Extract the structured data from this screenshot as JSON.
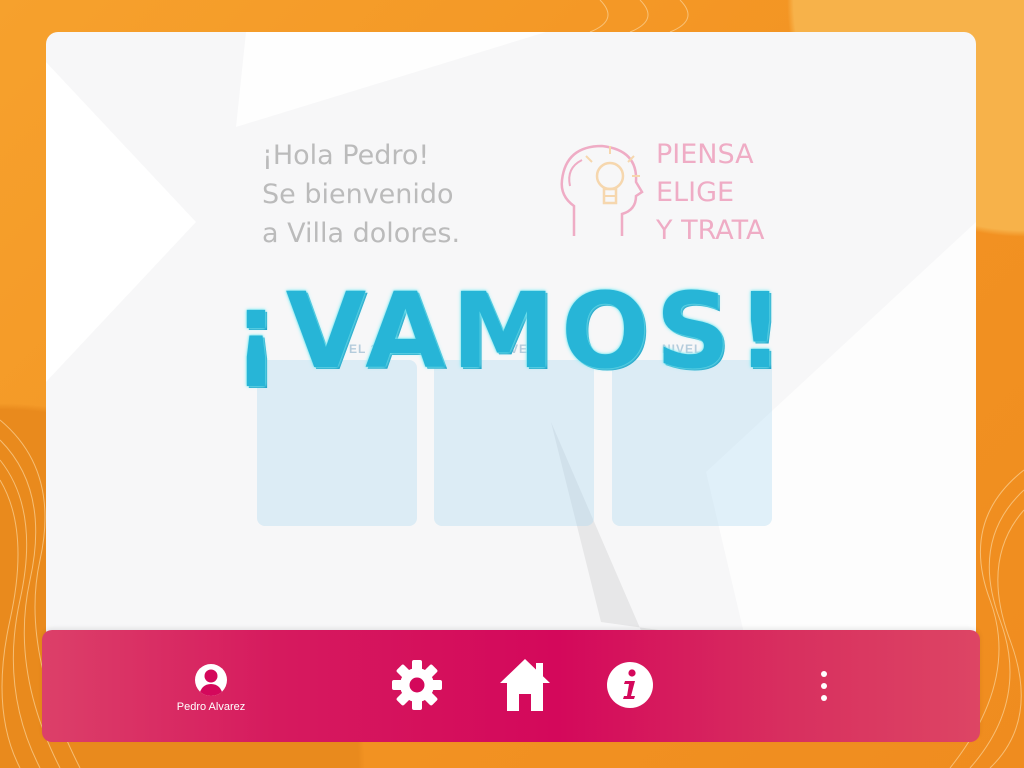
{
  "greeting": {
    "line1": "¡Hola Pedro!",
    "line2": "Se bienvenido",
    "line3": "a Villa dolores."
  },
  "slogan": {
    "line1": "PIENSA",
    "line2": "ELIGE",
    "line3": "Y TRATA",
    "icon": "head-lightbulb-icon"
  },
  "levels": [
    {
      "label": "NIVEL 1"
    },
    {
      "label": "NIVEL 2"
    },
    {
      "label": "NIVEL 3"
    }
  ],
  "overlay": {
    "text": "¡VAMOS!"
  },
  "navbar": {
    "user_name": "Pedro Alvarez",
    "icons": [
      "user-icon",
      "gear-icon",
      "home-icon",
      "info-icon",
      "more-vertical-icon"
    ]
  },
  "colors": {
    "background": "#f39a25",
    "navbar": "#d4085b",
    "accent_text": "#e02167",
    "overlay_text": "#27b5d7",
    "level_card": "#a9d8ef"
  }
}
